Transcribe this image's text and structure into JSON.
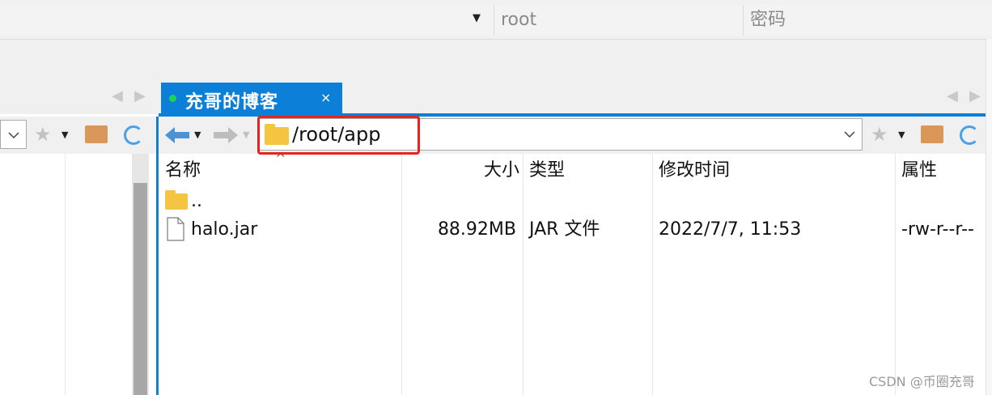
{
  "login_bar": {
    "username": "root",
    "password_placeholder": "密码"
  },
  "session_tab": {
    "title": "充哥的博客",
    "close": "×",
    "dot_color": "#1fd15a"
  },
  "tab_nav": {
    "prev": "◀",
    "next": "▶"
  },
  "address": {
    "path": "/root/app"
  },
  "file_list": {
    "columns": [
      "名称",
      "大小",
      "类型",
      "修改时间",
      "属性"
    ],
    "sort_indicator": "^",
    "rows": [
      {
        "name": "..",
        "size": "",
        "type": "",
        "modified": "",
        "attrs": "",
        "icon": "folder-icon"
      },
      {
        "name": "halo.jar",
        "size": "88.92MB",
        "type": "JAR 文件",
        "modified": "2022/7/7, 11:53",
        "attrs": "-rw-r--r--",
        "icon": "file-icon"
      }
    ]
  },
  "icons": {
    "back": "arrow-left-icon",
    "forward": "arrow-right-icon",
    "star": "star-icon",
    "home": "home-icon",
    "refresh": "refresh-icon",
    "dropdown": "chevron-down-icon"
  },
  "colors": {
    "accent": "#0c7fd8",
    "highlight": "#e8231c"
  },
  "watermark": "CSDN @币圈充哥"
}
